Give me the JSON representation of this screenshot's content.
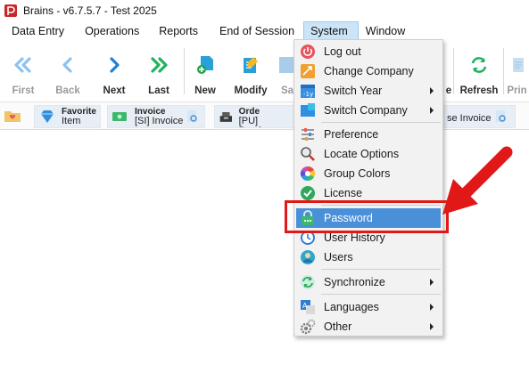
{
  "window": {
    "title": "Brains - v6.7.5.7 - Test 2025"
  },
  "menubar": {
    "items": [
      "Data Entry",
      "Operations",
      "Reports",
      "End of Session",
      "System",
      "Window"
    ]
  },
  "toolbar": {
    "first": "First",
    "back": "Back",
    "next": "Next",
    "last": "Last",
    "new": "New",
    "modify": "Modify",
    "save_partial": "Sa",
    "refresh": "Refresh",
    "print_partial": "Prin",
    "hidden_partial": "e"
  },
  "quickbar": {
    "favorite": {
      "title": "Favorite",
      "sub": "Item"
    },
    "invoice": {
      "title": "Invoice",
      "sub": "[SI] Invoice"
    },
    "purchase": {
      "title": "Purchase Orde",
      "sub": "[PU] Purchas"
    },
    "partial": {
      "sub": "se Invoice"
    }
  },
  "system_menu": {
    "items": [
      {
        "label": "Log out",
        "icon": "power-icon"
      },
      {
        "label": "Change Company",
        "icon": "change-company-icon"
      },
      {
        "label": "Switch Year",
        "icon": "calendar-icon",
        "submenu": true
      },
      {
        "label": "Switch Company",
        "icon": "company-icon",
        "submenu": true
      },
      {
        "label": "Preference",
        "icon": "sliders-icon"
      },
      {
        "label": "Locate Options",
        "icon": "magnifier-icon"
      },
      {
        "label": "Group Colors",
        "icon": "color-wheel-icon"
      },
      {
        "label": "License",
        "icon": "check-icon"
      },
      {
        "label": "Password",
        "icon": "password-icon",
        "highlighted": true
      },
      {
        "label": "User History",
        "icon": "clock-icon"
      },
      {
        "label": "Users",
        "icon": "user-icon"
      },
      {
        "label": "Synchronize",
        "icon": "sync-icon",
        "submenu": true
      },
      {
        "label": "Languages",
        "icon": "language-icon",
        "submenu": true
      },
      {
        "label": "Other",
        "icon": "gears-icon",
        "submenu": true
      }
    ]
  },
  "colors": {
    "menu_highlight": "#4a90d9",
    "annotation_red": "#e01818",
    "nav_blue": "#1f7fd8",
    "nav_green": "#1fb35b"
  }
}
